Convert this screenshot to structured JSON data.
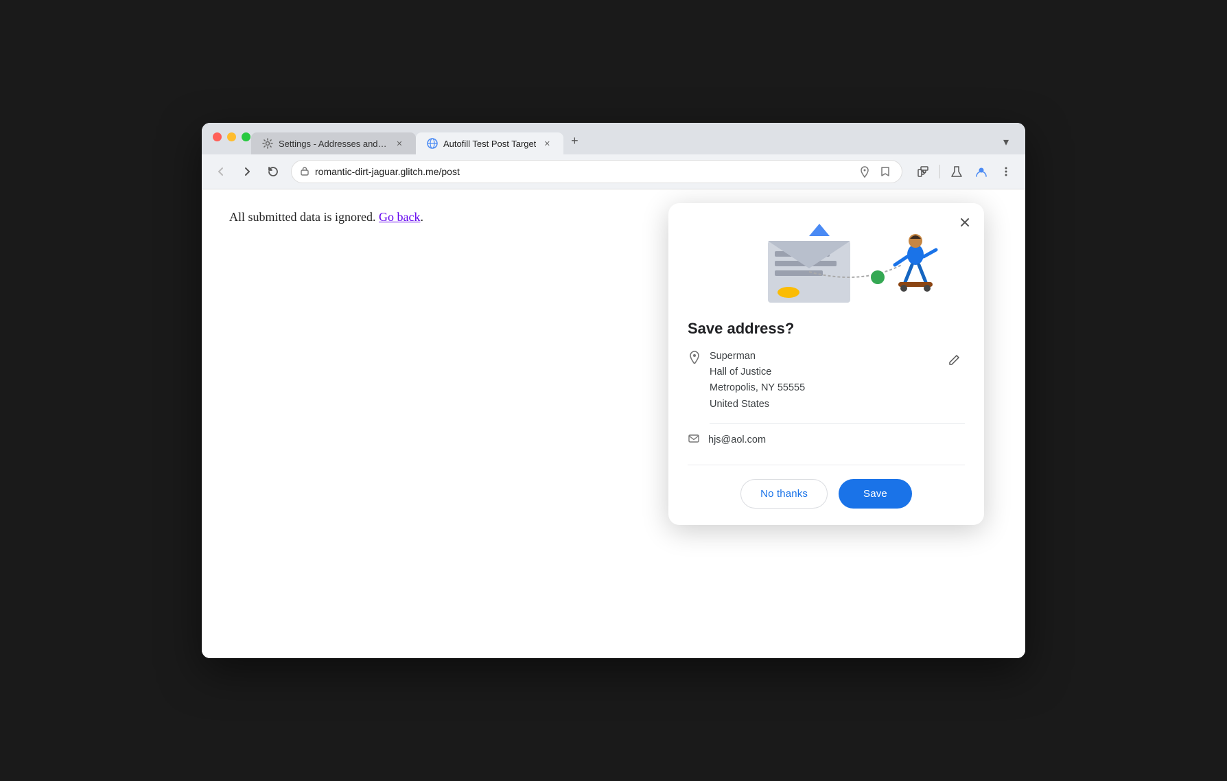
{
  "browser": {
    "tabs": [
      {
        "id": "tab-settings",
        "label": "Settings - Addresses and mo",
        "icon": "gear",
        "active": false
      },
      {
        "id": "tab-autofill",
        "label": "Autofill Test Post Target",
        "icon": "globe",
        "active": true
      }
    ],
    "new_tab_label": "+",
    "dropdown_label": "▾",
    "address_bar": {
      "url": "romantic-dirt-jaguar.glitch.me/post",
      "security_icon": "🔒"
    },
    "nav": {
      "back_label": "←",
      "forward_label": "→",
      "reload_label": "↻"
    }
  },
  "page": {
    "message": "All submitted data is ignored.",
    "go_back_link": "Go back"
  },
  "dialog": {
    "title": "Save address?",
    "close_label": "×",
    "address": {
      "name": "Superman",
      "line1": "Hall of Justice",
      "line2": "Metropolis, NY 55555",
      "line3": "United States"
    },
    "email": "hjs@aol.com",
    "actions": {
      "no_thanks": "No thanks",
      "save": "Save"
    }
  }
}
